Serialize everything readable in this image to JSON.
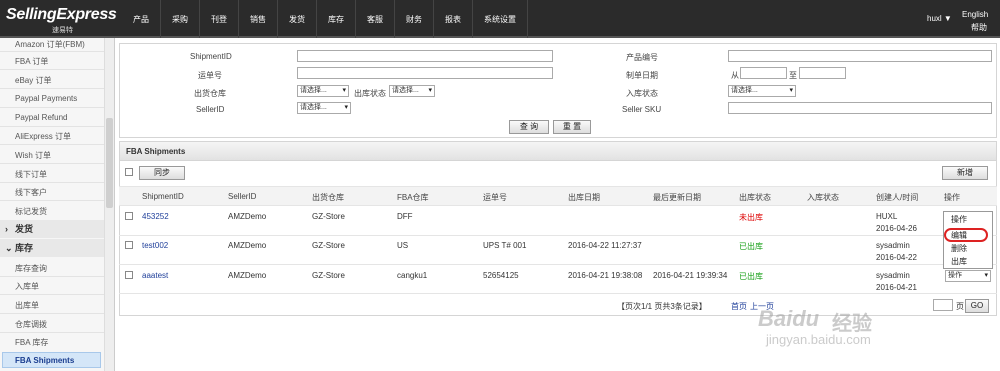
{
  "app": {
    "logo": "SellingExpress",
    "logo_sub": "速易特",
    "user": "huxl ▼",
    "lang": "English",
    "help": "帮助"
  },
  "nav": [
    "产品",
    "采购",
    "刊登",
    "销售",
    "发货",
    "库存",
    "客服",
    "财务",
    "报表",
    "系统设置"
  ],
  "sidebar": {
    "items_top": [
      "Amazon 订单(FBM)",
      "FBA 订单",
      "eBay 订单",
      "Paypal Payments",
      "Paypal Refund",
      "AliExpress 订单",
      "Wish 订单",
      "线下订单",
      "线下客户",
      "标记发货"
    ],
    "group_ship": {
      "arrow": "›",
      "label": "发货"
    },
    "group_inventory": {
      "arrow": "⌄",
      "label": "库存"
    },
    "items_inv": [
      "库存查询",
      "入库单",
      "出库单",
      "仓库调拨",
      "FBA 库存",
      "FBA Shipments"
    ]
  },
  "search": {
    "shipment_id": "ShipmentID",
    "tracking_no": "运单号",
    "out_warehouse": "出货仓库",
    "out_status": "出库状态",
    "seller_id": "SellerID",
    "product_code": "产品编号",
    "create_date": "制单日期",
    "from": "从",
    "to": "至",
    "in_status": "入库状态",
    "seller_sku": "Seller SKU",
    "select_placeholder": "请选择...",
    "query_btn": "查 询",
    "reset_btn": "重 置"
  },
  "list": {
    "title": "FBA Shipments",
    "sync_btn": "同步",
    "new_btn": "新增",
    "columns": [
      "ShipmentID",
      "SellerID",
      "出货仓库",
      "FBA仓库",
      "运单号",
      "出库日期",
      "最后更新日期",
      "出库状态",
      "入库状态",
      "创建人/时间",
      "操作"
    ],
    "rows": [
      {
        "shipment_id": "453252",
        "seller_id": "AMZDemo",
        "warehouse": "GZ-Store",
        "fba_warehouse": "DFF",
        "tracking": "",
        "out_date": "",
        "updated": "",
        "out_status": "未出库",
        "in_status": "",
        "creator": "HUXL",
        "created": "2016-04-26"
      },
      {
        "shipment_id": "test002",
        "seller_id": "AMZDemo",
        "warehouse": "GZ-Store",
        "fba_warehouse": "US",
        "tracking": "UPS T# 001",
        "out_date": "2016-04-22 11:27:37",
        "updated": "",
        "out_status": "已出库",
        "in_status": "",
        "creator": "sysadmin",
        "created": "2016-04-22"
      },
      {
        "shipment_id": "aaatest",
        "seller_id": "AMZDemo",
        "warehouse": "GZ-Store",
        "fba_warehouse": "cangku1",
        "tracking": "52654125",
        "out_date": "2016-04-21 19:38:08",
        "updated": "2016-04-21 19:39:34",
        "out_status": "已出库",
        "in_status": "",
        "creator": "sysadmin",
        "created": "2016-04-21"
      }
    ],
    "action_menu": {
      "title": "操作",
      "items": [
        "编辑",
        "删除",
        "出库"
      ],
      "select": "操作"
    },
    "pager": {
      "info": "【页次1/1   页共3条记录】",
      "first": "首页",
      "prev": "上一页",
      "page_suffix": "页",
      "go": "GO"
    }
  },
  "watermark": {
    "brand": "Baidu",
    "text": "经验",
    "url": "jingyan.baidu.com"
  }
}
